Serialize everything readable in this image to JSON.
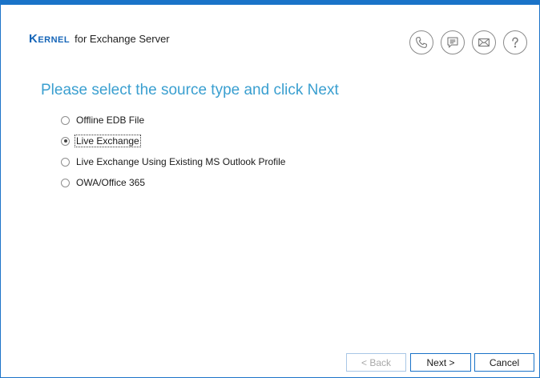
{
  "brand": {
    "logo": "Kernel",
    "product": "for Exchange Server"
  },
  "header_icons": [
    {
      "name": "phone-icon"
    },
    {
      "name": "chat-icon"
    },
    {
      "name": "mail-icon"
    },
    {
      "name": "help-icon"
    }
  ],
  "heading": "Please select the source type and click Next",
  "options": [
    {
      "label": "Offline EDB File",
      "checked": false
    },
    {
      "label": "Live Exchange",
      "checked": true
    },
    {
      "label": "Live Exchange Using Existing MS Outlook Profile",
      "checked": false
    },
    {
      "label": "OWA/Office 365",
      "checked": false
    }
  ],
  "buttons": {
    "back": "< Back",
    "next": "Next >",
    "cancel": "Cancel"
  },
  "colors": {
    "accent": "#1a73c8",
    "heading": "#3a9fd0"
  }
}
